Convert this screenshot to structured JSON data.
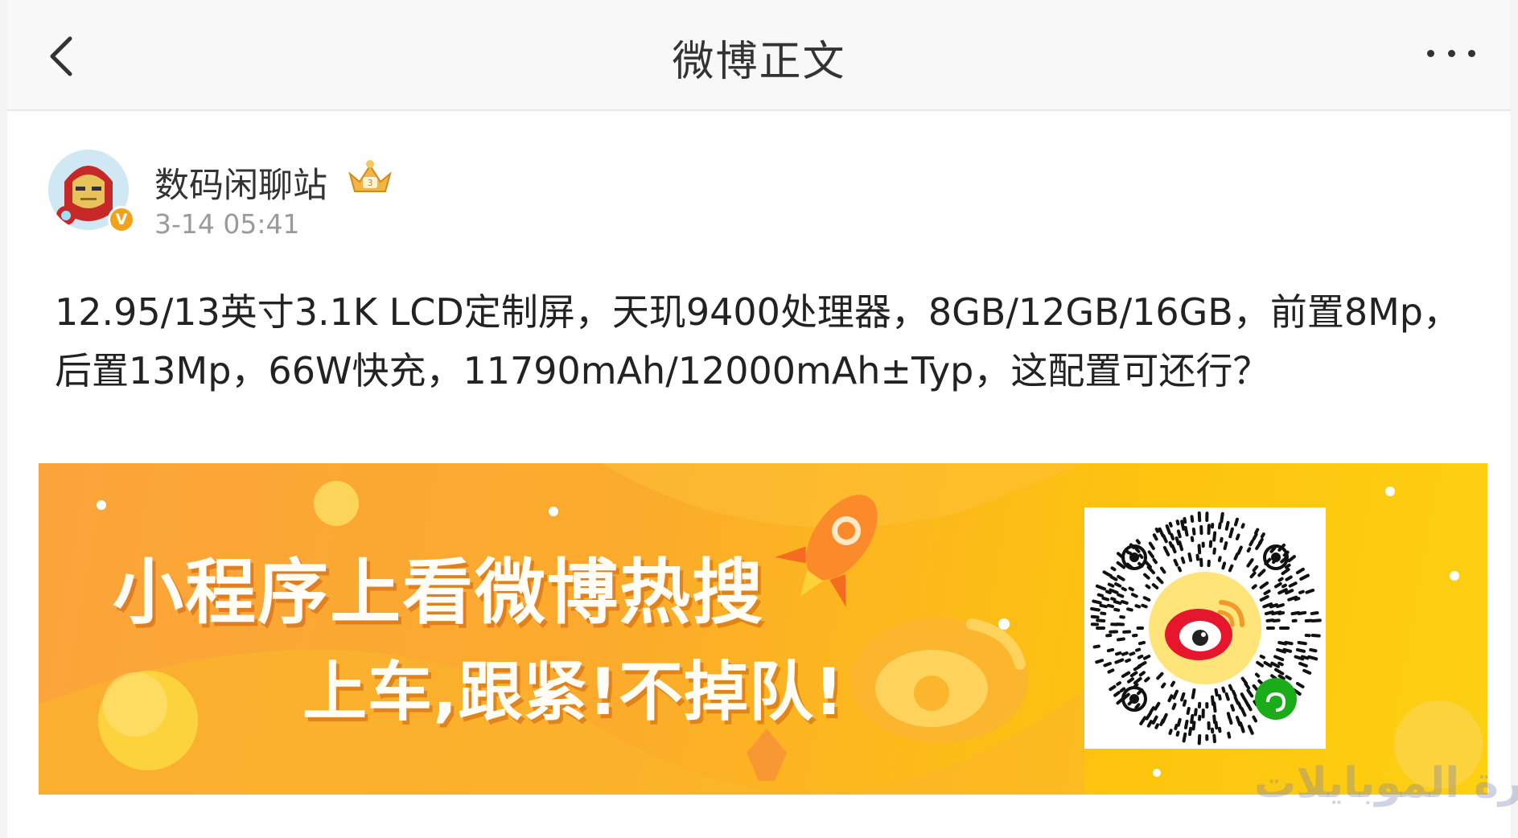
{
  "nav": {
    "title": "微博正文",
    "back_icon": "chevron-left-icon",
    "more_icon": "more-dots-icon"
  },
  "author": {
    "name": "数码闲聊站",
    "time": "3-14 05:41",
    "verified_mark": "V",
    "avatar_icon": "iron-man-avatar",
    "vip_icon": "vip-crown-badge-icon"
  },
  "post": {
    "text": "12.95/13英寸3.1K LCD定制屏，天玑9400处理器，8GB/12GB/16GB，前置8Mp，后置13Mp，66W快充，11790mAh/12000mAh±Typ，这配置可还行？"
  },
  "banner": {
    "line1": "小程序上看微博热搜",
    "line2": "上车,跟紧!不掉队!",
    "qr_icon": "weibo-miniprogram-qr-code"
  },
  "watermark": {
    "text": "حارة الموبايلات"
  },
  "colors": {
    "banner_orange": "#fba43b",
    "banner_yellow": "#fdd012",
    "weibo_red": "#e6162d",
    "miniprogram_green": "#1aad19"
  }
}
